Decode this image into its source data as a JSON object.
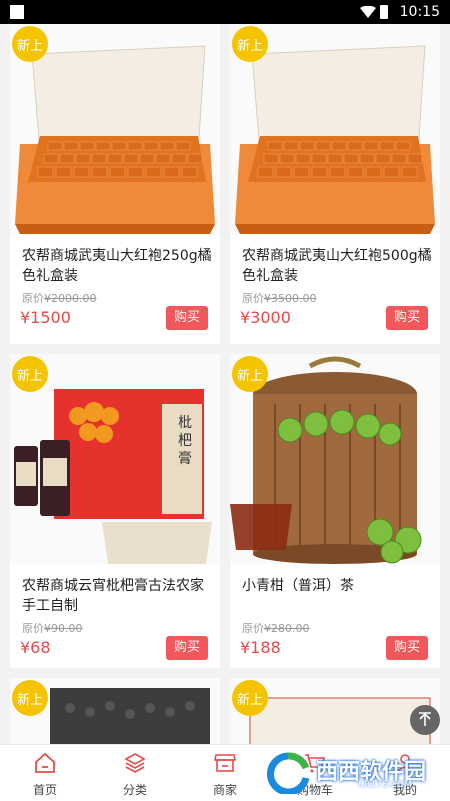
{
  "status_bar": {
    "time": "10:15"
  },
  "products": [
    {
      "badge": "新上",
      "title": "农帮商城武夷山大红袍250g橘色礼盒装",
      "orig_label": "原价",
      "orig_price": "¥2000.00",
      "price": "¥1500",
      "buy": "购买",
      "image": "orange-gift-box"
    },
    {
      "badge": "新上",
      "title": "农帮商城武夷山大红袍500g橘色礼盒装",
      "orig_label": "原价",
      "orig_price": "¥3500.00",
      "price": "¥3000",
      "buy": "购买",
      "image": "orange-gift-box"
    },
    {
      "badge": "新上",
      "title": "农帮商城云宵枇杷膏古法农家手工自制",
      "orig_label": "原价",
      "orig_price": "¥90.00",
      "price": "¥68",
      "buy": "购买",
      "image": "loquat-syrup",
      "box_text": "枇杷膏"
    },
    {
      "badge": "新上",
      "title": "小青柑（普洱）茶",
      "orig_label": "原价",
      "orig_price": "¥280.00",
      "price": "¥188",
      "buy": "购买",
      "image": "wooden-tea-barrel"
    },
    {
      "badge": "新上"
    },
    {
      "badge": "新上"
    }
  ],
  "tabbar": {
    "items": [
      {
        "label": "首页",
        "icon": "home-icon",
        "active": true
      },
      {
        "label": "分类",
        "icon": "layers-icon"
      },
      {
        "label": "商家",
        "icon": "store-icon"
      },
      {
        "label": "购物车",
        "icon": "cart-icon"
      },
      {
        "label": "我的",
        "icon": "user-icon"
      }
    ]
  },
  "watermark": {
    "text": "西西软件园",
    "sub": "CR173.COM"
  },
  "colors": {
    "badge": "#f5c400",
    "price": "#e64b4b",
    "buy": "#f2585b",
    "active_tab": "#e64b4b"
  }
}
